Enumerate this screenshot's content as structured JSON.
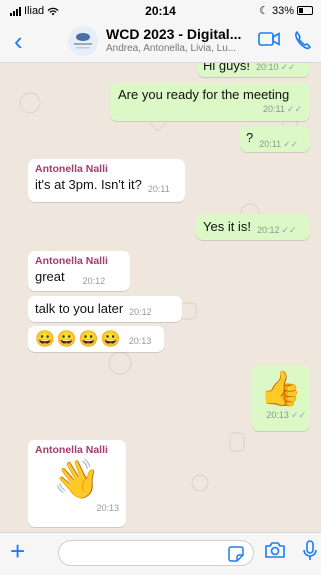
{
  "status_bar": {
    "carrier": "Iliad",
    "time": "20:14",
    "battery": "33%"
  },
  "header": {
    "back_icon": "chevron-left",
    "title": "WCD 2023 - Digital...",
    "subtitle": "Andrea, Antonella, Livia, Lu...",
    "video_icon": "video-camera",
    "phone_icon": "phone"
  },
  "messages": [
    {
      "direction": "out",
      "text": "Hi guys!",
      "time": "20:10",
      "ticks": "✓✓"
    },
    {
      "direction": "out",
      "text": "Are you ready for the meeting",
      "time": "20:11",
      "ticks": "✓✓"
    },
    {
      "direction": "out",
      "text": "?",
      "time": "20:11",
      "ticks": "✓✓"
    },
    {
      "direction": "in",
      "sender": "Antonella Nalli",
      "text": "it's at 3pm. Isn't it?",
      "time": "20:11"
    },
    {
      "direction": "out",
      "text": "Yes it is!",
      "time": "20:12",
      "ticks": "✓✓"
    },
    {
      "direction": "in",
      "sender": "Antonella Nalli",
      "text": "great",
      "time": "20:12"
    },
    {
      "direction": "in",
      "text": "talk to you later",
      "time": "20:12"
    },
    {
      "direction": "in",
      "text": "😀😀😀😀",
      "time": "20:13"
    },
    {
      "direction": "out",
      "text": "👍",
      "time": "20:13",
      "ticks": "✓✓"
    },
    {
      "direction": "in",
      "sender": "Antonella Nalli",
      "text": "👋",
      "time": "20:13"
    }
  ],
  "composer": {
    "plus_icon": "plus",
    "sticker_icon": "sticker",
    "camera_icon": "camera",
    "mic_icon": "microphone"
  },
  "colors": {
    "accent": "#1e7cf2",
    "outgoing_bubble": "#dcf8c6",
    "incoming_bubble": "#ffffff",
    "sender_name": "#a23b6e",
    "chat_background": "#efe7dd"
  }
}
